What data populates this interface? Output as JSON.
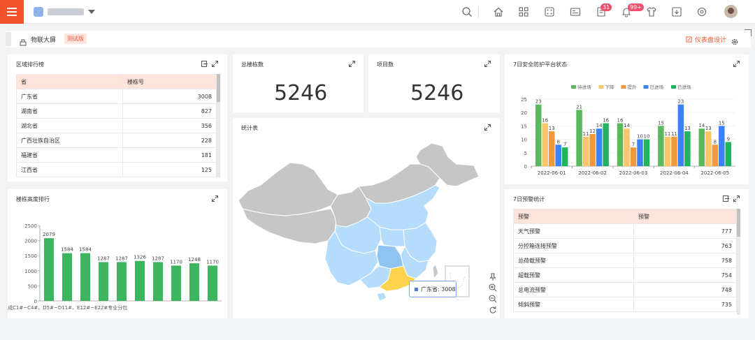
{
  "header": {
    "notifications_task_count": "31",
    "notifications_bell_count": "99+"
  },
  "breadcrumb": {
    "title": "物联大屏",
    "tag": "测试版",
    "design_label": "仪表盘设计"
  },
  "region_ranking": {
    "title": "区域排行榜",
    "columns": [
      "省",
      "楼栋号"
    ],
    "rows": [
      [
        "广东省",
        "3008"
      ],
      [
        "湖南省",
        "827"
      ],
      [
        "湖北省",
        "356"
      ],
      [
        "广西壮族自治区",
        "228"
      ],
      [
        "福建省",
        "181"
      ],
      [
        "江西省",
        "125"
      ]
    ]
  },
  "total_buildings": {
    "title": "总楼栋数",
    "value": "5246"
  },
  "project_count": {
    "title": "项目数",
    "value": "5246"
  },
  "stats_map": {
    "title": "统计表",
    "tooltip": "广东省: 3008",
    "highlight_color": "#fcd34d"
  },
  "safety_chart": {
    "title": "7日安全防护平台状态",
    "chart_data": {
      "type": "bar",
      "categories": [
        "2022-06-01",
        "2022-06-02",
        "2022-06-03",
        "2022-06-04",
        "2022-06-05"
      ],
      "ylim": [
        0,
        25
      ],
      "yticks": [
        0,
        5,
        10,
        15,
        20,
        25
      ],
      "series": [
        {
          "name": "待进场",
          "color": "#5cb85c",
          "values": [
            23,
            21,
            16,
            15,
            14
          ]
        },
        {
          "name": "下降",
          "color": "#fbc66a",
          "values": [
            16,
            11,
            14,
            11,
            13
          ]
        },
        {
          "name": "提升",
          "color": "#f0983a",
          "values": [
            13,
            12,
            7,
            11,
            8
          ]
        },
        {
          "name": "已进场",
          "color": "#3b82f6",
          "values": [
            8,
            14,
            10,
            23,
            15
          ]
        },
        {
          "name": "已进场",
          "color": "#22b35e",
          "values": [
            7,
            16,
            10,
            13,
            9
          ]
        }
      ]
    }
  },
  "height_chart": {
    "title": "楼栋高度排行",
    "xlabel": "成C1#~C4#、D5#~D11#、E12#~E22#专业分包",
    "chart_data": {
      "type": "bar",
      "values": [
        2079,
        1584,
        1584,
        1287,
        1287,
        1326,
        1287,
        1170,
        1248,
        1170
      ],
      "ylim": [
        0,
        2500
      ],
      "yticks": [
        0,
        500,
        1000,
        1500,
        2000,
        2500
      ],
      "color": "#3cb55e"
    }
  },
  "warning_table": {
    "title": "7日预警统计",
    "columns": [
      "预警",
      "预警"
    ],
    "rows": [
      [
        "天气预警",
        "777"
      ],
      [
        "分控箱连接预警",
        "763"
      ],
      [
        "总荷载预警",
        "758"
      ],
      [
        "超载预警",
        "754"
      ],
      [
        "总电流预警",
        "748"
      ],
      [
        "倾斜预警",
        "735"
      ]
    ]
  }
}
